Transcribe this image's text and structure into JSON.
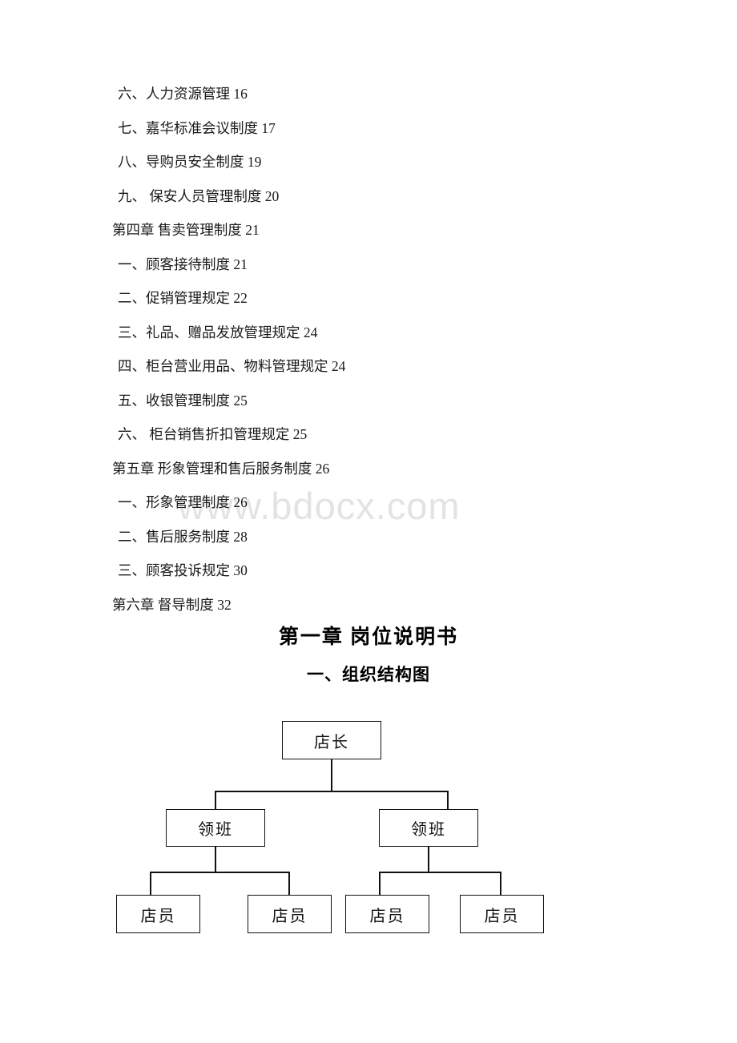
{
  "document": {
    "watermark": "www.bdocx.com",
    "toc": [
      {
        "level": "item",
        "text": "六、人力资源管理 16"
      },
      {
        "level": "item",
        "text": "七、嘉华标准会议制度 17"
      },
      {
        "level": "item",
        "text": "八、导购员安全制度 19"
      },
      {
        "level": "item",
        "text": "九、 保安人员管理制度 20"
      },
      {
        "level": "chapter",
        "text": "第四章 售卖管理制度 21"
      },
      {
        "level": "item",
        "text": "一、顾客接待制度 21"
      },
      {
        "level": "item",
        "text": "二、促销管理规定 22"
      },
      {
        "level": "item",
        "text": "三、礼品、赠品发放管理规定 24"
      },
      {
        "level": "item",
        "text": "四、柜台营业用品、物料管理规定 24"
      },
      {
        "level": "item",
        "text": "五、收银管理制度 25"
      },
      {
        "level": "item",
        "text": "六、 柜台销售折扣管理规定 25"
      },
      {
        "level": "chapter",
        "text": "第五章 形象管理和售后服务制度 26"
      },
      {
        "level": "item",
        "text": "一、形象管理制度 26"
      },
      {
        "level": "item",
        "text": "二、售后服务制度 28"
      },
      {
        "level": "item",
        "text": "三、顾客投诉规定 30"
      },
      {
        "level": "chapter",
        "text": "第六章 督导制度 32"
      }
    ],
    "chapter_title": "第一章 岗位说明书",
    "section_title": "一、组织结构图",
    "org_chart": {
      "manager": "店长",
      "supervisor_left": "领班",
      "supervisor_right": "领班",
      "staff_1": "店员",
      "staff_2": "店员",
      "staff_3": "店员",
      "staff_4": "店员"
    }
  }
}
